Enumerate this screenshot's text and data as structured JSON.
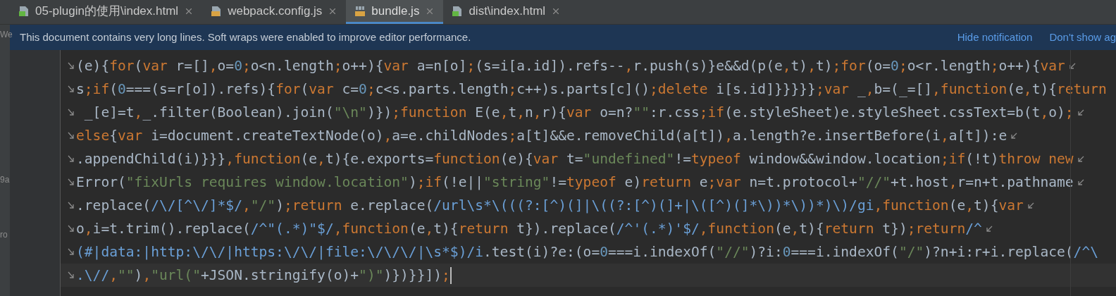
{
  "tabs": [
    {
      "label": "05-plugin的使用\\index.html",
      "kind": "html",
      "selected": false
    },
    {
      "label": "webpack.config.js",
      "kind": "js",
      "selected": false
    },
    {
      "label": "bundle.js",
      "kind": "binary",
      "selected": true
    },
    {
      "label": "dist\\index.html",
      "kind": "html",
      "selected": false
    }
  ],
  "sidebar": {
    "items": [
      {
        "label": "We",
        "selected": false
      },
      {
        "label": "9a",
        "selected": false
      },
      {
        "label": "ro",
        "selected": false
      }
    ]
  },
  "notification": {
    "message": "This document contains very long lines. Soft wraps were enabled to improve editor performance.",
    "actions": [
      "Hide notification",
      "Don't show ag"
    ]
  },
  "editor": {
    "lines": [
      {
        "current": false,
        "wrap_end": true,
        "tokens": [
          {
            "kind": "tx",
            "text": "(e){"
          },
          {
            "kind": "kw",
            "text": "for"
          },
          {
            "kind": "tx",
            "text": "("
          },
          {
            "kind": "kw",
            "text": "var"
          },
          {
            "kind": "tx",
            "text": " r=[]"
          },
          {
            "kind": "kw",
            "text": ","
          },
          {
            "kind": "tx",
            "text": "o="
          },
          {
            "kind": "num",
            "text": "0"
          },
          {
            "kind": "kw",
            "text": ";"
          },
          {
            "kind": "tx",
            "text": "o<n.length"
          },
          {
            "kind": "kw",
            "text": ";"
          },
          {
            "kind": "tx",
            "text": "o++){"
          },
          {
            "kind": "kw",
            "text": "var"
          },
          {
            "kind": "tx",
            "text": " a=n[o]"
          },
          {
            "kind": "kw",
            "text": ";"
          },
          {
            "kind": "tx",
            "text": "(s=i[a.id]).refs--"
          },
          {
            "kind": "kw",
            "text": ","
          },
          {
            "kind": "tx",
            "text": "r.push(s)}e&&d(p(e"
          },
          {
            "kind": "kw",
            "text": ","
          },
          {
            "kind": "tx",
            "text": "t)"
          },
          {
            "kind": "kw",
            "text": ","
          },
          {
            "kind": "tx",
            "text": "t)"
          },
          {
            "kind": "kw",
            "text": ";for"
          },
          {
            "kind": "tx",
            "text": "(o="
          },
          {
            "kind": "num",
            "text": "0"
          },
          {
            "kind": "kw",
            "text": ";"
          },
          {
            "kind": "tx",
            "text": "o<r.length"
          },
          {
            "kind": "kw",
            "text": ";"
          },
          {
            "kind": "tx",
            "text": "o++){"
          },
          {
            "kind": "kw",
            "text": "var"
          }
        ]
      },
      {
        "current": false,
        "wrap_end": false,
        "tokens": [
          {
            "kind": "tx",
            "text": "s"
          },
          {
            "kind": "kw",
            "text": ";if"
          },
          {
            "kind": "tx",
            "text": "("
          },
          {
            "kind": "num",
            "text": "0"
          },
          {
            "kind": "tx",
            "text": "===(s=r[o]).refs){"
          },
          {
            "kind": "kw",
            "text": "for"
          },
          {
            "kind": "tx",
            "text": "("
          },
          {
            "kind": "kw",
            "text": "var"
          },
          {
            "kind": "tx",
            "text": " c="
          },
          {
            "kind": "num",
            "text": "0"
          },
          {
            "kind": "kw",
            "text": ";"
          },
          {
            "kind": "tx",
            "text": "c<s.parts.length"
          },
          {
            "kind": "kw",
            "text": ";"
          },
          {
            "kind": "tx",
            "text": "c++)s.parts[c]()"
          },
          {
            "kind": "kw",
            "text": ";delete"
          },
          {
            "kind": "tx",
            "text": " i[s.id]}}}}}"
          },
          {
            "kind": "kw",
            "text": ";var"
          },
          {
            "kind": "tx",
            "text": " _"
          },
          {
            "kind": "kw",
            "text": ","
          },
          {
            "kind": "tx",
            "text": "b=(_=[]"
          },
          {
            "kind": "kw",
            "text": ",function"
          },
          {
            "kind": "tx",
            "text": "(e"
          },
          {
            "kind": "kw",
            "text": ","
          },
          {
            "kind": "tx",
            "text": "t){"
          },
          {
            "kind": "kw",
            "text": "return"
          }
        ]
      },
      {
        "current": false,
        "wrap_end": true,
        "tokens": [
          {
            "kind": "tx",
            "text": " _[e]=t"
          },
          {
            "kind": "kw",
            "text": ","
          },
          {
            "kind": "tx",
            "text": "_.filter(Boolean).join("
          },
          {
            "kind": "str",
            "text": "\"\\n\""
          },
          {
            "kind": "tx",
            "text": ")})"
          },
          {
            "kind": "kw",
            "text": ";function"
          },
          {
            "kind": "tx",
            "text": " E(e"
          },
          {
            "kind": "kw",
            "text": ","
          },
          {
            "kind": "tx",
            "text": "t"
          },
          {
            "kind": "kw",
            "text": ","
          },
          {
            "kind": "tx",
            "text": "n"
          },
          {
            "kind": "kw",
            "text": ","
          },
          {
            "kind": "tx",
            "text": "r){"
          },
          {
            "kind": "kw",
            "text": "var"
          },
          {
            "kind": "tx",
            "text": " o=n?"
          },
          {
            "kind": "str",
            "text": "\"\""
          },
          {
            "kind": "tx",
            "text": ":r.css"
          },
          {
            "kind": "kw",
            "text": ";if"
          },
          {
            "kind": "tx",
            "text": "(e.styleSheet)e.styleSheet.cssText=b(t"
          },
          {
            "kind": "kw",
            "text": ","
          },
          {
            "kind": "tx",
            "text": "o)"
          },
          {
            "kind": "kw",
            "text": ";"
          }
        ]
      },
      {
        "current": false,
        "wrap_end": true,
        "tokens": [
          {
            "kind": "kw",
            "text": "else"
          },
          {
            "kind": "tx",
            "text": "{"
          },
          {
            "kind": "kw",
            "text": "var"
          },
          {
            "kind": "tx",
            "text": " i=document.createTextNode(o)"
          },
          {
            "kind": "kw",
            "text": ","
          },
          {
            "kind": "tx",
            "text": "a=e.childNodes"
          },
          {
            "kind": "kw",
            "text": ";"
          },
          {
            "kind": "tx",
            "text": "a[t]&&e.removeChild(a[t])"
          },
          {
            "kind": "kw",
            "text": ","
          },
          {
            "kind": "tx",
            "text": "a.length?e.insertBefore(i"
          },
          {
            "kind": "kw",
            "text": ","
          },
          {
            "kind": "tx",
            "text": "a[t]):e"
          }
        ]
      },
      {
        "current": false,
        "wrap_end": true,
        "tokens": [
          {
            "kind": "tx",
            "text": ".appendChild(i)}}}"
          },
          {
            "kind": "kw",
            "text": ",function"
          },
          {
            "kind": "tx",
            "text": "(e"
          },
          {
            "kind": "kw",
            "text": ","
          },
          {
            "kind": "tx",
            "text": "t){e.exports="
          },
          {
            "kind": "kw",
            "text": "function"
          },
          {
            "kind": "tx",
            "text": "(e){"
          },
          {
            "kind": "kw",
            "text": "var"
          },
          {
            "kind": "tx",
            "text": " t="
          },
          {
            "kind": "str",
            "text": "\"undefined\""
          },
          {
            "kind": "tx",
            "text": "!="
          },
          {
            "kind": "kw",
            "text": "typeof"
          },
          {
            "kind": "tx",
            "text": " window&&window.location"
          },
          {
            "kind": "kw",
            "text": ";if"
          },
          {
            "kind": "tx",
            "text": "(!t)"
          },
          {
            "kind": "kw",
            "text": "throw new"
          }
        ]
      },
      {
        "current": false,
        "wrap_end": true,
        "tokens": [
          {
            "kind": "tx",
            "text": "Error("
          },
          {
            "kind": "str",
            "text": "\"fixUrls requires window.location\""
          },
          {
            "kind": "tx",
            "text": ")"
          },
          {
            "kind": "kw",
            "text": ";if"
          },
          {
            "kind": "tx",
            "text": "(!e||"
          },
          {
            "kind": "str",
            "text": "\"string\""
          },
          {
            "kind": "tx",
            "text": "!="
          },
          {
            "kind": "kw",
            "text": "typeof"
          },
          {
            "kind": "tx",
            "text": " e)"
          },
          {
            "kind": "kw",
            "text": "return"
          },
          {
            "kind": "tx",
            "text": " e"
          },
          {
            "kind": "kw",
            "text": ";var"
          },
          {
            "kind": "tx",
            "text": " n=t.protocol+"
          },
          {
            "kind": "str",
            "text": "\"//\""
          },
          {
            "kind": "tx",
            "text": "+t.host"
          },
          {
            "kind": "kw",
            "text": ","
          },
          {
            "kind": "tx",
            "text": "r=n+t.pathname"
          }
        ]
      },
      {
        "current": false,
        "wrap_end": true,
        "tokens": [
          {
            "kind": "tx",
            "text": ".replace("
          },
          {
            "kind": "re",
            "text": "/\\/[^\\/]*$/"
          },
          {
            "kind": "kw",
            "text": ","
          },
          {
            "kind": "str",
            "text": "\"/\""
          },
          {
            "kind": "tx",
            "text": ")"
          },
          {
            "kind": "kw",
            "text": ";return"
          },
          {
            "kind": "tx",
            "text": " e.replace("
          },
          {
            "kind": "re",
            "text": "/url\\s*\\(((?:[^)(]|\\((?:[^)(]+|\\([^)(]*\\))*\\))*)\\)/gi"
          },
          {
            "kind": "kw",
            "text": ",function"
          },
          {
            "kind": "tx",
            "text": "(e"
          },
          {
            "kind": "kw",
            "text": ","
          },
          {
            "kind": "tx",
            "text": "t){"
          },
          {
            "kind": "kw",
            "text": "var"
          }
        ]
      },
      {
        "current": false,
        "wrap_end": true,
        "tokens": [
          {
            "kind": "tx",
            "text": "o"
          },
          {
            "kind": "kw",
            "text": ","
          },
          {
            "kind": "tx",
            "text": "i=t.trim().replace("
          },
          {
            "kind": "re",
            "text": "/^\"(.*)\"$/"
          },
          {
            "kind": "kw",
            "text": ",function"
          },
          {
            "kind": "tx",
            "text": "(e"
          },
          {
            "kind": "kw",
            "text": ","
          },
          {
            "kind": "tx",
            "text": "t){"
          },
          {
            "kind": "kw",
            "text": "return"
          },
          {
            "kind": "tx",
            "text": " t}).replace("
          },
          {
            "kind": "re",
            "text": "/^'(.*)'$/"
          },
          {
            "kind": "kw",
            "text": ",function"
          },
          {
            "kind": "tx",
            "text": "(e"
          },
          {
            "kind": "kw",
            "text": ","
          },
          {
            "kind": "tx",
            "text": "t){"
          },
          {
            "kind": "kw",
            "text": "return"
          },
          {
            "kind": "tx",
            "text": " t})"
          },
          {
            "kind": "kw",
            "text": ";return"
          },
          {
            "kind": "re",
            "text": "/^"
          }
        ]
      },
      {
        "current": false,
        "wrap_end": false,
        "tokens": [
          {
            "kind": "re",
            "text": "(#|data:|http:\\/\\/|https:\\/\\/|file:\\/\\/\\/|\\s*$)/i"
          },
          {
            "kind": "tx",
            "text": ".test(i)?e:(o="
          },
          {
            "kind": "num",
            "text": "0"
          },
          {
            "kind": "tx",
            "text": "===i.indexOf("
          },
          {
            "kind": "str",
            "text": "\"//\""
          },
          {
            "kind": "tx",
            "text": ")?i:"
          },
          {
            "kind": "num",
            "text": "0"
          },
          {
            "kind": "tx",
            "text": "===i.indexOf("
          },
          {
            "kind": "str",
            "text": "\"/\""
          },
          {
            "kind": "tx",
            "text": ")?n+i:r+i.replace("
          },
          {
            "kind": "re",
            "text": "/^\\"
          }
        ]
      },
      {
        "current": true,
        "wrap_end": false,
        "tokens": [
          {
            "kind": "re",
            "text": ".\\//"
          },
          {
            "kind": "kw",
            "text": ","
          },
          {
            "kind": "str",
            "text": "\"\""
          },
          {
            "kind": "tx",
            "text": ")"
          },
          {
            "kind": "kw",
            "text": ","
          },
          {
            "kind": "str",
            "text": "\"url(\""
          },
          {
            "kind": "tx",
            "text": "+JSON.stringify(o)+"
          },
          {
            "kind": "str",
            "text": "\")\""
          },
          {
            "kind": "tx",
            "text": ")})}}])"
          },
          {
            "kind": "kw",
            "text": ";"
          }
        ]
      }
    ]
  }
}
